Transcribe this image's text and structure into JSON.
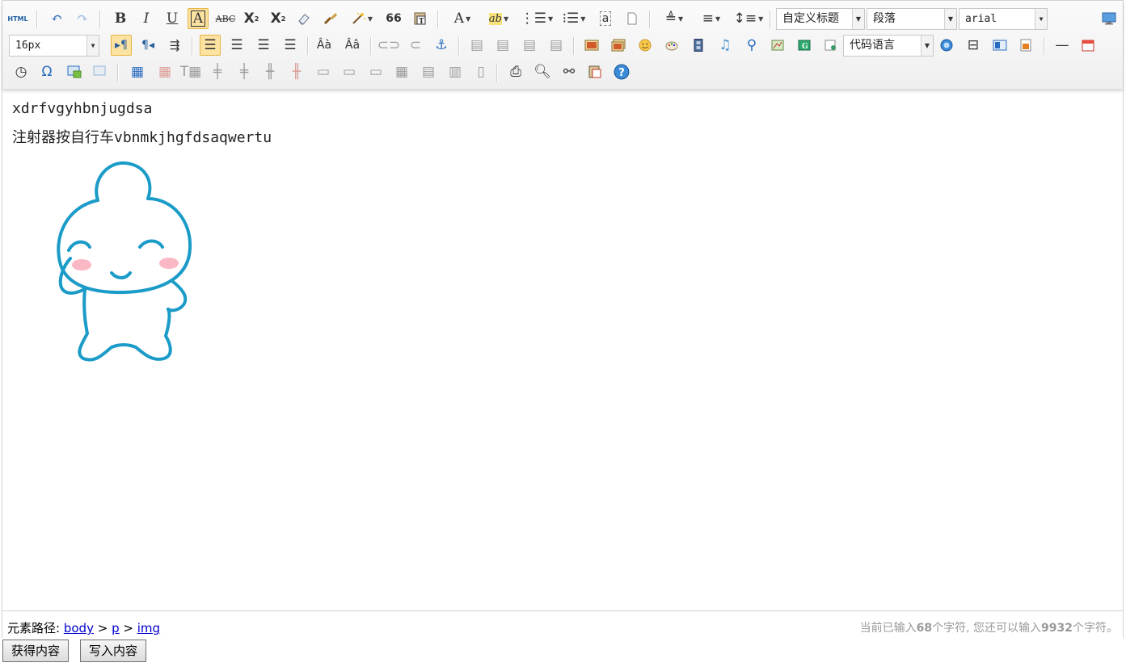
{
  "toolbar": {
    "row1": {
      "html_label": "HTML",
      "bold": "B",
      "italic": "I",
      "underline": "U",
      "fontborder": "A",
      "strike": "ABC",
      "superscript": "X",
      "subscript": "X",
      "quote": "66",
      "forecolor": "A",
      "backcolor": "ab",
      "custom_heading": "自定义标题",
      "paragraph": "段落",
      "font_family": "arial"
    },
    "row2": {
      "font_size": "16px",
      "code_language": "代码语言"
    }
  },
  "content": {
    "line1": "xdrfvgyhbnjugdsa",
    "line2": "注射器按自行车vbnmkjhgfdsaqwertu"
  },
  "status": {
    "path_label": "元素路径:",
    "path": [
      "body",
      "p",
      "img"
    ],
    "count_prefix": "当前已输入",
    "count_used": "68",
    "count_mid": "个字符, 您还可以输入",
    "count_left": "9932",
    "count_suffix": "个字符。"
  },
  "buttons": {
    "get_content": "获得内容",
    "set_content": "写入内容"
  },
  "colors": {
    "accent_active": "#fde3a2",
    "link": "#0000cc",
    "mascot": "#1a9bc8",
    "cheek": "#f7a6b4"
  }
}
